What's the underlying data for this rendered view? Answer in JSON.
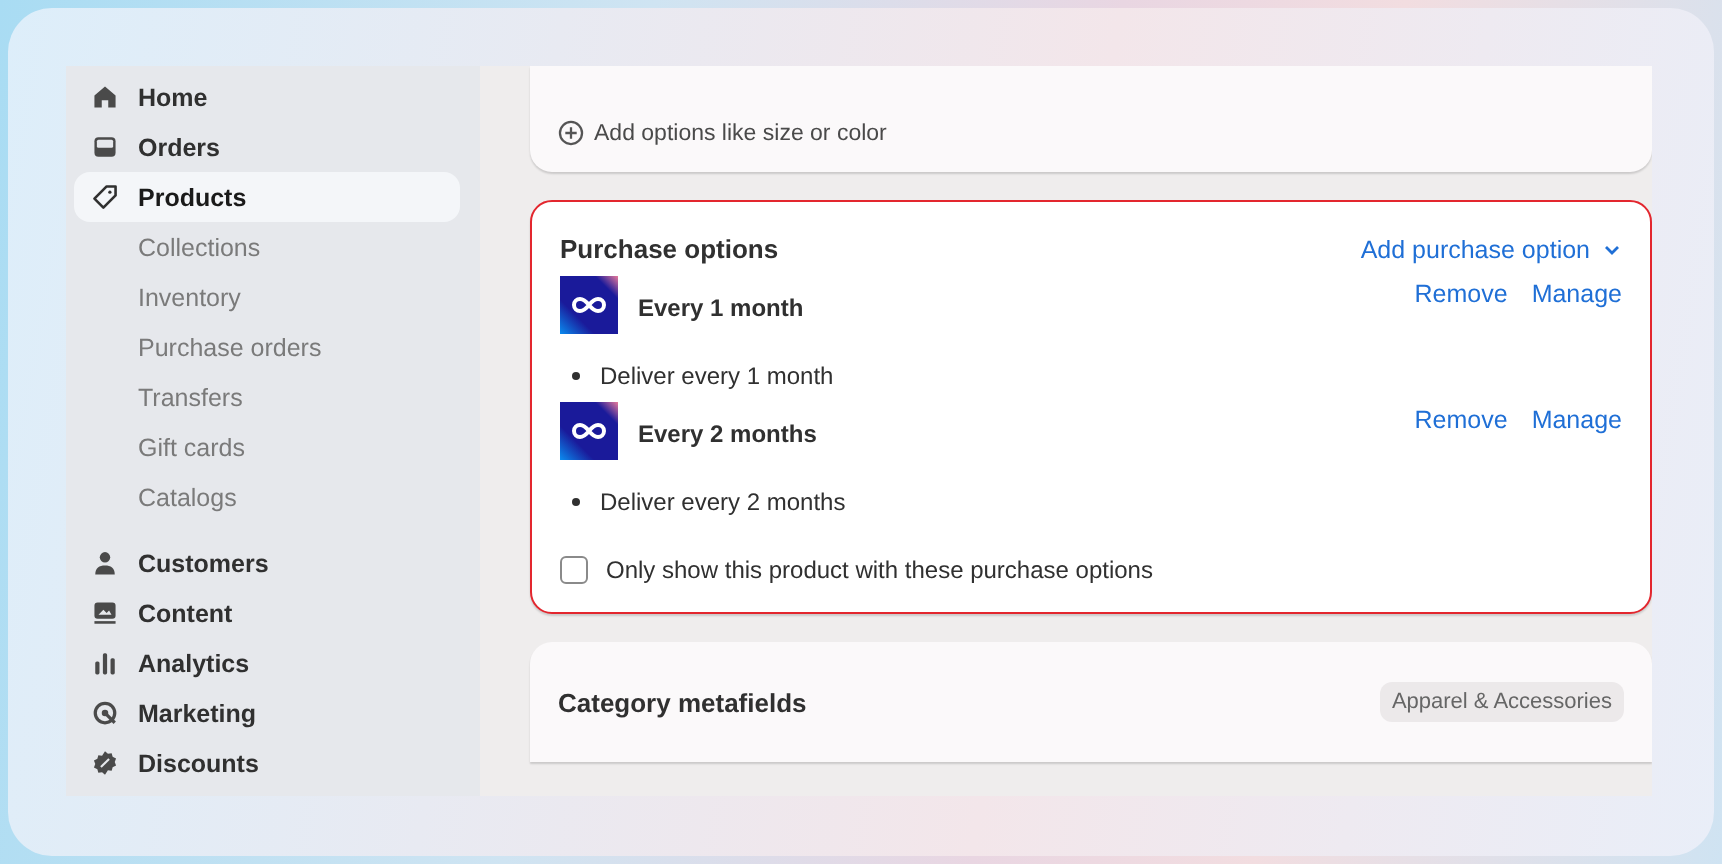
{
  "sidebar": {
    "items": [
      {
        "label": "Home",
        "kind": "main",
        "selected": false
      },
      {
        "label": "Orders",
        "kind": "main",
        "selected": false
      },
      {
        "label": "Products",
        "kind": "main",
        "selected": true
      },
      {
        "label": "Collections",
        "kind": "sub",
        "selected": false
      },
      {
        "label": "Inventory",
        "kind": "sub",
        "selected": false
      },
      {
        "label": "Purchase orders",
        "kind": "sub",
        "selected": false
      },
      {
        "label": "Transfers",
        "kind": "sub",
        "selected": false
      },
      {
        "label": "Gift cards",
        "kind": "sub",
        "selected": false
      },
      {
        "label": "Catalogs",
        "kind": "sub",
        "selected": false
      },
      {
        "label": "Customers",
        "kind": "main",
        "selected": false
      },
      {
        "label": "Content",
        "kind": "main",
        "selected": false
      },
      {
        "label": "Analytics",
        "kind": "main",
        "selected": false
      },
      {
        "label": "Marketing",
        "kind": "main",
        "selected": false
      },
      {
        "label": "Discounts",
        "kind": "main",
        "selected": false
      }
    ]
  },
  "variants": {
    "add_label": "Add options like size or color"
  },
  "purchase_options": {
    "title": "Purchase options",
    "add_button": "Add purchase option",
    "options": [
      {
        "name": "Every 1 month",
        "detail": "Deliver every 1 month",
        "remove": "Remove",
        "manage": "Manage"
      },
      {
        "name": "Every 2 months",
        "detail": "Deliver every 2 months",
        "remove": "Remove",
        "manage": "Manage"
      }
    ],
    "only_show": {
      "label": "Only show this product with these purchase options",
      "checked": false
    }
  },
  "category_metafields": {
    "title": "Category metafields",
    "badge": "Apparel & Accessories"
  }
}
